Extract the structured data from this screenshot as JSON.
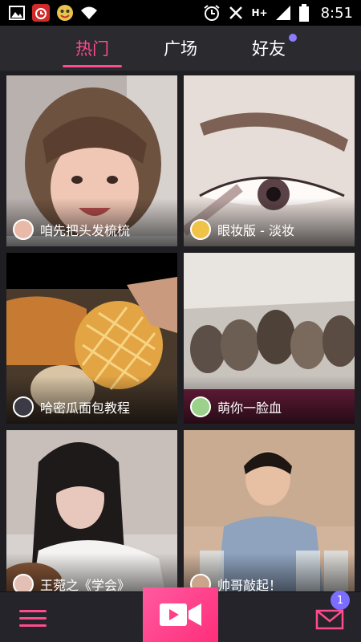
{
  "status_bar": {
    "time": "8:51",
    "left_icons": [
      "image-icon",
      "alarm-app-icon",
      "emoji-app-icon",
      "wifi-icon"
    ],
    "right_icons": [
      "alarm-clock-icon",
      "mute-icon",
      "h-plus-signal-icon",
      "signal-bars-icon",
      "battery-icon"
    ],
    "network_label": "H+"
  },
  "tabs": [
    {
      "label": "热门",
      "active": true
    },
    {
      "label": "广场",
      "active": false
    },
    {
      "label": "好友",
      "active": false,
      "has_dot": true
    }
  ],
  "cards": [
    {
      "title": "咱先把头发梳梳"
    },
    {
      "title": "眼妆版 - 淡妆"
    },
    {
      "title": "哈密瓜面包教程"
    },
    {
      "title": "萌你一脸血"
    },
    {
      "title": "王菀之《学会》"
    },
    {
      "title": "帅哥敲起！"
    }
  ],
  "bottom_bar": {
    "menu_icon": "menu-icon",
    "record_icon": "video-camera-icon",
    "mail_icon": "mail-icon",
    "mail_badge": "1"
  },
  "colors": {
    "accent": "#ff4b8f",
    "badge": "#7a6dff",
    "background": "#1f1f23"
  }
}
